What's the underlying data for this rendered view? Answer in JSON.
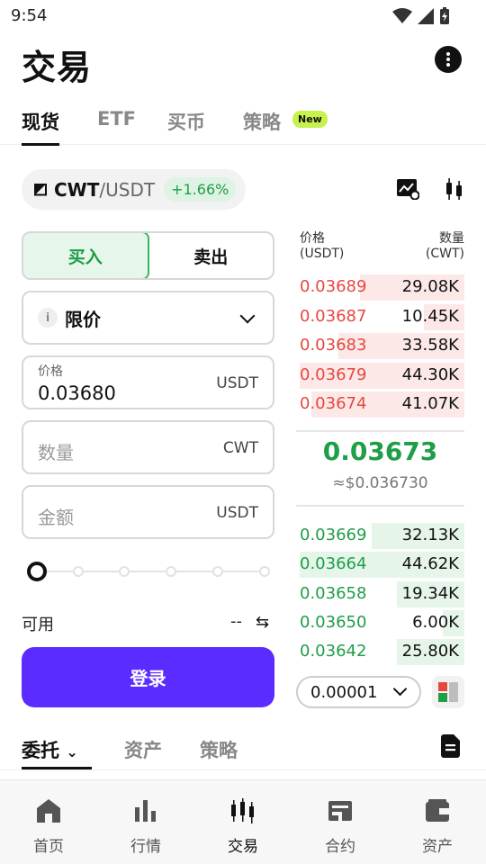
{
  "status_bar": {
    "time": "9:54"
  },
  "header": {
    "title": "交易"
  },
  "top_tabs": [
    {
      "label": "现货"
    },
    {
      "label": "ETF"
    },
    {
      "label": "买币"
    },
    {
      "label": "策略"
    }
  ],
  "new_badge": "New",
  "pair": {
    "base": "CWT",
    "quote": "/USDT",
    "change": "+1.66%"
  },
  "trade_form": {
    "buy_label": "买入",
    "sell_label": "卖出",
    "order_type_icon": "i",
    "order_type": "限价",
    "price_label": "价格",
    "price_value": "0.03680",
    "price_unit": "USDT",
    "quantity_placeholder": "数量",
    "quantity_unit": "CWT",
    "amount_placeholder": "金额",
    "amount_unit": "USDT",
    "slider_percent": 0,
    "available_label": "可用",
    "available_value": "--",
    "submit_label": "登录"
  },
  "order_book": {
    "price_header_line1": "价格",
    "price_header_line2": "(USDT)",
    "qty_header_line1": "数量",
    "qty_header_line2": "(CWT)",
    "asks": [
      {
        "price": "0.03689",
        "qty": "29.08K",
        "depth": 0.62
      },
      {
        "price": "0.03687",
        "qty": "10.45K",
        "depth": 0.24
      },
      {
        "price": "0.03683",
        "qty": "33.58K",
        "depth": 0.75
      },
      {
        "price": "0.03679",
        "qty": "44.30K",
        "depth": 0.98
      },
      {
        "price": "0.03674",
        "qty": "41.07K",
        "depth": 0.91
      }
    ],
    "last_price": "0.03673",
    "last_price_fiat": "≈$0.036730",
    "bids": [
      {
        "price": "0.03669",
        "qty": "32.13K",
        "depth": 0.55
      },
      {
        "price": "0.03664",
        "qty": "44.62K",
        "depth": 0.98
      },
      {
        "price": "0.03658",
        "qty": "19.34K",
        "depth": 0.4
      },
      {
        "price": "0.03650",
        "qty": "6.00K",
        "depth": 0.13
      },
      {
        "price": "0.03642",
        "qty": "25.80K",
        "depth": 0.4
      }
    ],
    "depth_step": "0.00001",
    "colors": {
      "ask": "#e5483f",
      "bid": "#1f9d47"
    }
  },
  "sub_tabs": [
    {
      "label": "委托"
    },
    {
      "label": "资产"
    },
    {
      "label": "策略"
    }
  ],
  "bottom_nav": [
    {
      "label": "首页",
      "icon": "home-icon"
    },
    {
      "label": "行情",
      "icon": "market-chart-icon"
    },
    {
      "label": "交易",
      "icon": "trade-candles-icon"
    },
    {
      "label": "合约",
      "icon": "futures-icon"
    },
    {
      "label": "资产",
      "icon": "wallet-icon"
    }
  ],
  "colors": {
    "accent": "#5b2cff",
    "up": "#1f9d47",
    "down": "#e5483f",
    "badge": "#c6f24e"
  }
}
